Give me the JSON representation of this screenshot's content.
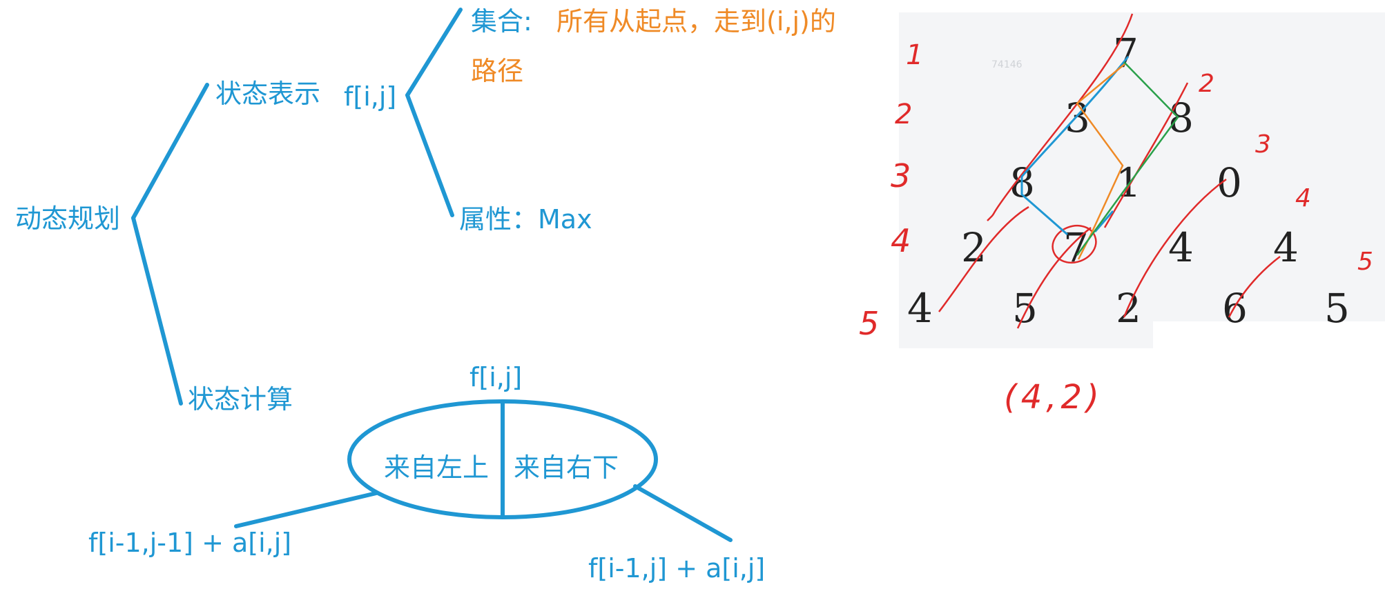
{
  "colors": {
    "blue": "#1f97d3",
    "orange": "#ef8a26",
    "red": "#e02a2a",
    "green": "#2aa04a"
  },
  "tree": {
    "root": "动态规划",
    "state_repr": "状态表示",
    "state_repr_fn": "f[i,j]",
    "set_prefix": "集合:",
    "set_desc_line1": "所有从起点，走到(i,j)的",
    "set_desc_line2": "路径",
    "attribute": "属性：Max",
    "state_calc": "状态计算",
    "calc_fn": "f[i,j]",
    "from_upper_left": "来自左上",
    "from_lower_right": "来自右下",
    "formula_left": "f[i-1,j-1] + a[i,j]",
    "formula_right": "f[i-1,j] + a[i,j]"
  },
  "triangle": {
    "rows": [
      [
        "7"
      ],
      [
        "3",
        "8"
      ],
      [
        "8",
        "1",
        "0"
      ],
      [
        "2",
        "7",
        "4",
        "4"
      ],
      [
        "4",
        "5",
        "2",
        "6",
        "5"
      ]
    ],
    "watermark": "74146"
  },
  "annotations": {
    "row_numbers": [
      "1",
      "2",
      "3",
      "4",
      "5"
    ],
    "diag_numbers": [
      "2",
      "3",
      "4",
      "5"
    ],
    "coord": "(4,2)"
  }
}
